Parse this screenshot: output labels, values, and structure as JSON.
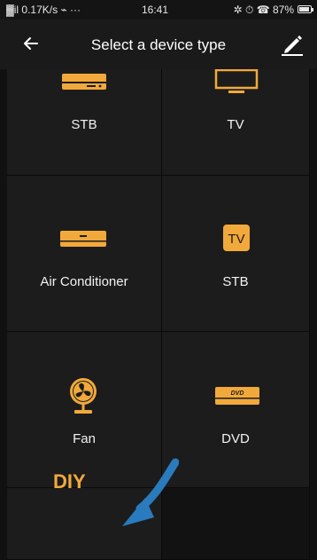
{
  "status_bar": {
    "signal_speed": "▓il 0.17K/s ⌁ ···",
    "time": "16:41",
    "right_icons": "✲ ⏱ ☎ 87%",
    "battery_level": 0.87
  },
  "header": {
    "title": "Select a device type",
    "back_icon": "arrow-left-icon",
    "edit_icon": "pencil-icon"
  },
  "devices": [
    {
      "label": "STB",
      "icon": "set-top-box-icon"
    },
    {
      "label": "TV",
      "icon": "tv-icon"
    },
    {
      "label": "Air Conditioner",
      "icon": "air-conditioner-icon"
    },
    {
      "label": "STB",
      "icon": "stb-tv-badge-icon",
      "badge": "TV"
    },
    {
      "label": "Fan",
      "icon": "fan-icon"
    },
    {
      "label": "DVD",
      "icon": "dvd-player-icon",
      "badge": "DVD"
    },
    {
      "label": "DIY",
      "icon": "diy-icon"
    }
  ],
  "colors": {
    "accent": "#f2a93b",
    "background": "#111111",
    "tile": "#1c1c1c",
    "arrow": "#2a7bbd"
  }
}
